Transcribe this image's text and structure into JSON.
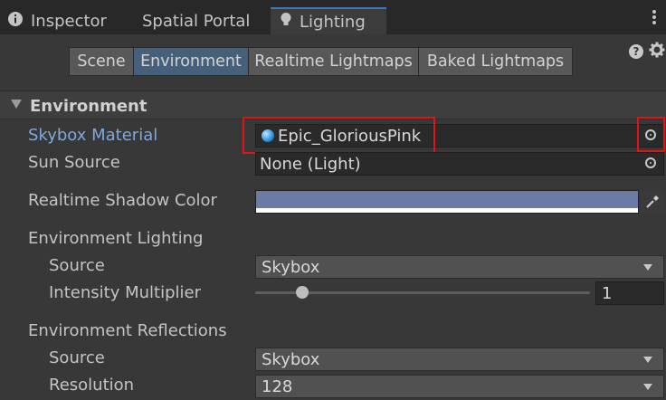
{
  "tabs": [
    {
      "label": "Inspector",
      "icon": "info-icon"
    },
    {
      "label": "Spatial Portal",
      "icon": ""
    },
    {
      "label": "Lighting",
      "icon": "lightbulb-icon"
    }
  ],
  "toolbar": {
    "scene": "Scene",
    "environment": "Environment",
    "realtime_lightmaps": "Realtime Lightmaps",
    "baked_lightmaps": "Baked Lightmaps"
  },
  "help_glyph": "?",
  "section": {
    "title": "Environment"
  },
  "fields": {
    "skybox_material": {
      "label": "Skybox Material",
      "value": "Epic_GloriousPink"
    },
    "sun_source": {
      "label": "Sun Source",
      "value": "None (Light)"
    },
    "realtime_shadow_color": {
      "label": "Realtime Shadow Color",
      "color": "#6c7aa6"
    },
    "env_lighting": {
      "label": "Environment Lighting"
    },
    "env_lighting_source": {
      "label": "Source",
      "value": "Skybox"
    },
    "intensity_multiplier": {
      "label": "Intensity Multiplier",
      "value": "1",
      "slider_fraction": 0.14
    },
    "env_reflections": {
      "label": "Environment Reflections"
    },
    "env_reflections_source": {
      "label": "Source",
      "value": "Skybox"
    },
    "resolution": {
      "label": "Resolution",
      "value": "128"
    }
  },
  "colors": {
    "accent": "#3a79bb",
    "highlight": "#e01414",
    "label_active": "#7fa8dc"
  }
}
